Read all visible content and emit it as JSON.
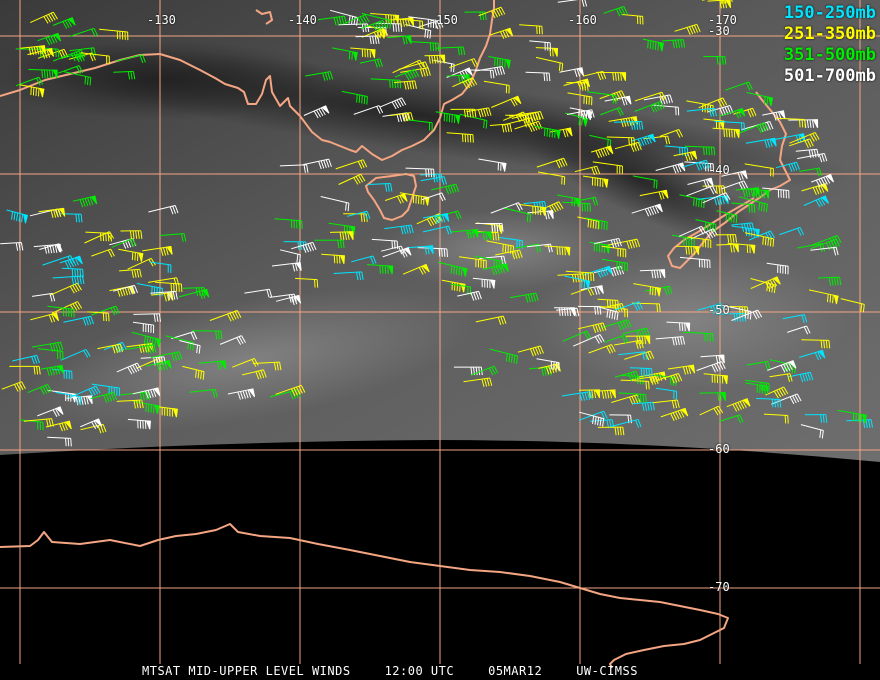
{
  "map": {
    "longitude_labels": [
      "-130",
      "-140",
      "-150",
      "-160",
      "-170"
    ],
    "latitude_labels": [
      "-30",
      "-40",
      "-50",
      "-60",
      "-70"
    ],
    "legend": [
      {
        "label": "150-250mb",
        "color": "#00e5ff"
      },
      {
        "label": "251-350mb",
        "color": "#ffff00"
      },
      {
        "label": "351-500mb",
        "color": "#00ee00"
      },
      {
        "label": "501-700mb",
        "color": "#ffffff"
      }
    ],
    "coastline_color": "#f4a582",
    "gridline_color": "#f4a582",
    "caption": {
      "product": "MTSAT MID-UPPER LEVEL WINDS",
      "time": "12:00 UTC",
      "date": "05MAR12",
      "source": "UW-CIMSS"
    }
  }
}
